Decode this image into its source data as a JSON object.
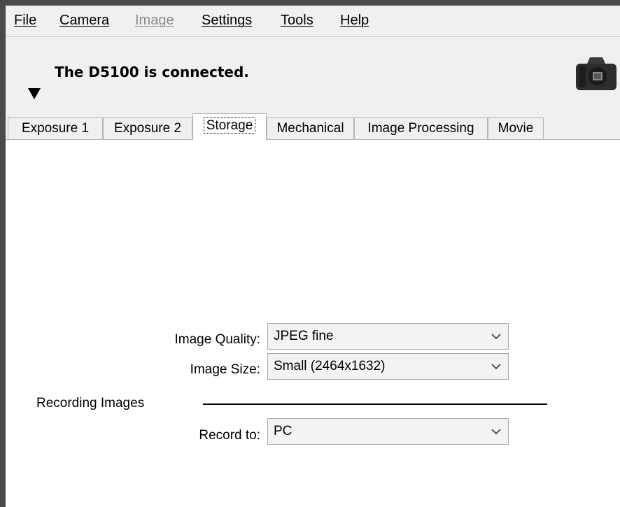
{
  "menu": [
    {
      "label": "File",
      "enabled": true
    },
    {
      "label": "Camera",
      "enabled": true
    },
    {
      "label": "Image",
      "enabled": false
    },
    {
      "label": "Settings",
      "enabled": true
    },
    {
      "label": "Tools",
      "enabled": true
    },
    {
      "label": "Help",
      "enabled": true
    }
  ],
  "status": {
    "text": "The D5100 is connected.",
    "icon": "camera-icon"
  },
  "tabs": [
    {
      "label": "Exposure 1"
    },
    {
      "label": "Exposure 2"
    },
    {
      "label": "Storage",
      "active": true
    },
    {
      "label": "Mechanical"
    },
    {
      "label": "Image Processing"
    },
    {
      "label": "Movie"
    }
  ],
  "storage": {
    "image_quality": {
      "label": "Image Quality:",
      "value": "JPEG fine"
    },
    "image_size": {
      "label": "Image Size:",
      "value": "Small (2464x1632)"
    },
    "section_label": "Recording Images",
    "record_to": {
      "label": "Record to:",
      "value": "PC"
    }
  }
}
